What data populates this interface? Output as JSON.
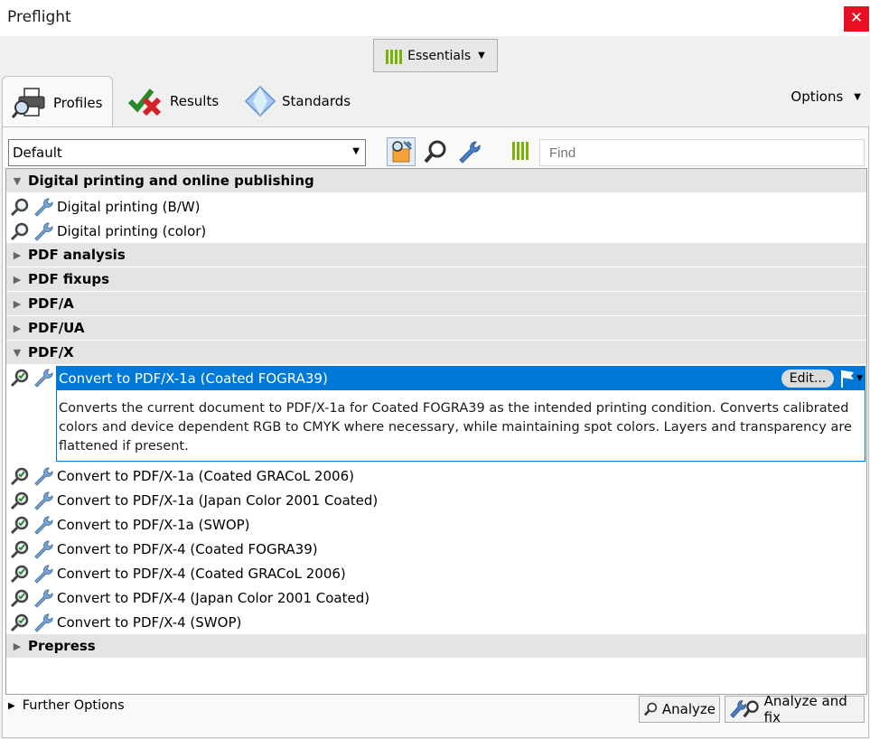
{
  "window": {
    "title": "Preflight",
    "close_glyph": "✕"
  },
  "workspace": {
    "label": "Essentials",
    "icon": "bar-chart-icon"
  },
  "tabs": [
    {
      "label": "Profiles",
      "icon": "printer-magnifier-icon",
      "active": true
    },
    {
      "label": "Results",
      "icon": "check-cross-icon",
      "active": false
    },
    {
      "label": "Standards",
      "icon": "diamond-icon",
      "active": false
    }
  ],
  "options_label": "Options",
  "toolbar": {
    "profile_value": "Default",
    "find_placeholder": "Find",
    "tools": [
      "profile-actions-icon",
      "analyze-icon",
      "fix-icon",
      "bar-chart-icon"
    ]
  },
  "list": {
    "groups": [
      {
        "label": "Digital printing and online publishing",
        "expanded": true
      },
      {
        "label": "PDF analysis",
        "expanded": false
      },
      {
        "label": "PDF fixups",
        "expanded": false
      },
      {
        "label": "PDF/A",
        "expanded": false
      },
      {
        "label": "PDF/UA",
        "expanded": false
      },
      {
        "label": "PDF/X",
        "expanded": true
      },
      {
        "label": "Prepress",
        "expanded": false
      }
    ],
    "digital_items": [
      "Digital printing (B/W)",
      "Digital printing (color)"
    ],
    "selected": {
      "label": "Convert to PDF/X-1a (Coated FOGRA39)",
      "edit_label": "Edit...",
      "description": "Converts the current document to PDF/X-1a for Coated FOGRA39 as the intended printing condition. Converts calibrated colors and device dependent RGB to CMYK where necessary, while maintaining spot colors. Layers and transparency are flattened if present."
    },
    "pdfx_items": [
      "Convert to PDF/X-1a (Coated GRACoL 2006)",
      "Convert to PDF/X-1a (Japan Color 2001 Coated)",
      "Convert to PDF/X-1a (SWOP)",
      "Convert to PDF/X-4 (Coated FOGRA39)",
      "Convert to PDF/X-4 (Coated GRACoL 2006)",
      "Convert to PDF/X-4 (Japan Color 2001 Coated)",
      "Convert to PDF/X-4 (SWOP)"
    ]
  },
  "footer": {
    "further_options": "Further Options",
    "analyze": "Analyze",
    "analyze_fix": "Analyze and fix"
  },
  "colors": {
    "accent": "#0078d7",
    "close": "#e81123",
    "chart_green": "#77b300"
  }
}
